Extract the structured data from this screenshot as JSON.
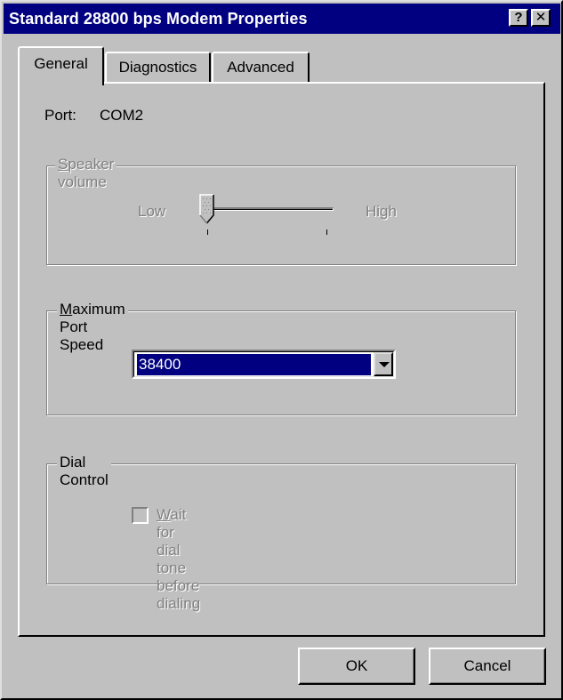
{
  "window": {
    "title": "Standard 28800 bps Modem Properties",
    "help_label": "?",
    "close_label": "✕"
  },
  "tabs": [
    {
      "label": "General",
      "active": true
    },
    {
      "label": "Diagnostics",
      "active": false
    },
    {
      "label": "Advanced",
      "active": false
    }
  ],
  "general": {
    "port_label": "Port:",
    "port_value": "COM2",
    "speaker_volume": {
      "title_first": "S",
      "title_rest": "peaker volume",
      "low_label": "Low",
      "high_label": "High",
      "level": 0,
      "enabled": false
    },
    "max_port_speed": {
      "title_first": "M",
      "title_rest": "aximum Port Speed",
      "selected": "38400"
    },
    "dial_control": {
      "title": "Dial Control",
      "checkbox_first": "W",
      "checkbox_rest": "ait for dial tone before dialing",
      "checked": false,
      "enabled": false
    }
  },
  "buttons": {
    "ok_label": "OK",
    "cancel_label": "Cancel"
  }
}
